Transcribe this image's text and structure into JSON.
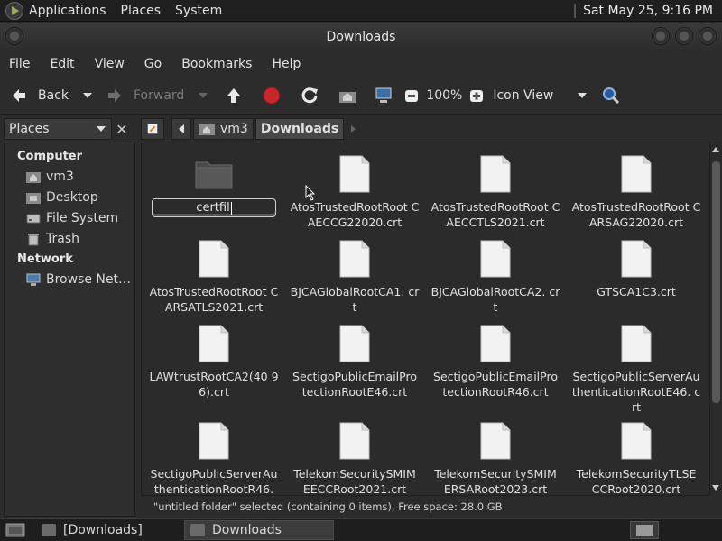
{
  "top_panel": {
    "menus": [
      "Applications",
      "Places",
      "System"
    ],
    "clock": "Sat May 25,  9:16 PM"
  },
  "window": {
    "title": "Downloads"
  },
  "menubar": [
    "File",
    "Edit",
    "View",
    "Go",
    "Bookmarks",
    "Help"
  ],
  "toolbar": {
    "back": "Back",
    "forward": "Forward",
    "zoom": "100%",
    "view_mode": "Icon View"
  },
  "places": {
    "selector": "Places",
    "sections": [
      {
        "heading": "Computer",
        "items": [
          "vm3",
          "Desktop",
          "File System",
          "Trash"
        ]
      },
      {
        "heading": "Network",
        "items": [
          "Browse Net…"
        ]
      }
    ]
  },
  "pathbar": {
    "segments": [
      "vm3",
      "Downloads"
    ]
  },
  "files": {
    "rename_value": "certfil",
    "items": [
      "AtosTrustedRootRoot CAECCG22020.crt",
      "AtosTrustedRootRoot CAECCTLS2021.crt",
      "AtosTrustedRootRoot CARSAG22020.crt",
      "AtosTrustedRootRoot CARSATLS2021.crt",
      "BJCAGlobalRootCA1. crt",
      "BJCAGlobalRootCA2. crt",
      "GTSCA1C3.crt",
      "LAWtrustRootCA2(40 96).crt",
      "SectigoPublicEmailPro tectionRootE46.crt",
      "SectigoPublicEmailPro tectionRootR46.crt",
      "SectigoPublicServerAu thenticationRootE46. crt",
      "SectigoPublicServerAu thenticationRootR46.",
      "TelekomSecuritySMIM EECCRoot2021.crt",
      "TelekomSecuritySMIM ERSARoot2023.crt",
      "TelekomSecurityTLSE CCRoot2020.crt"
    ]
  },
  "statusbar": "\"untitled folder\" selected (containing 0 items), Free space: 28.0 GB",
  "taskbar": {
    "tasks": [
      "[Downloads]",
      "Downloads"
    ]
  },
  "colors": {
    "accent": "#4a90d9",
    "stop": "#d32f2f",
    "path_active": "#474747"
  }
}
